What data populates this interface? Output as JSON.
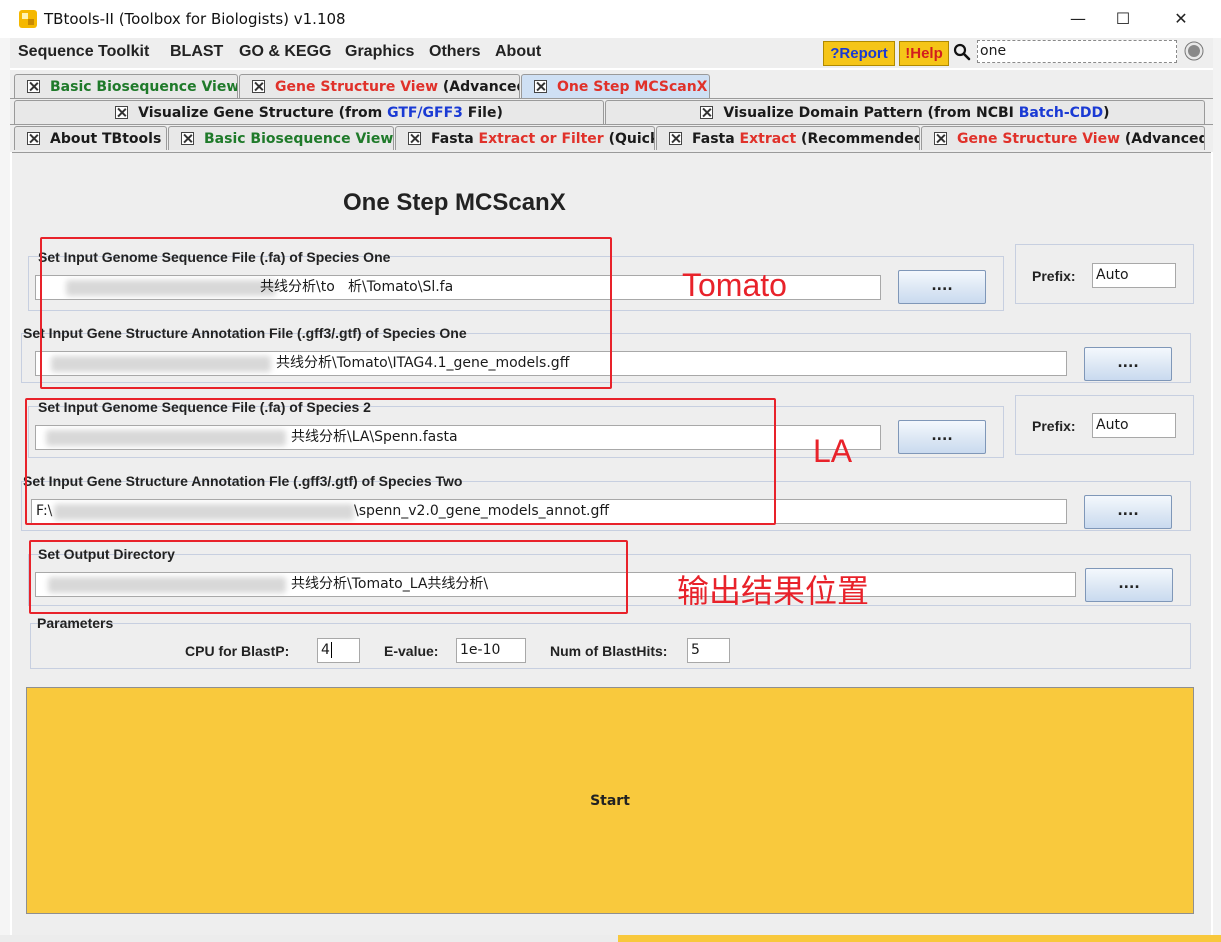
{
  "window": {
    "title": "TBtools-II (Toolbox for Biologists) v1.108",
    "minimize": "—",
    "maximize": "☐",
    "close": "✕"
  },
  "menu": {
    "items": [
      "Sequence Toolkit",
      "BLAST",
      "GO & KEGG",
      "Graphics",
      "Others",
      "About"
    ],
    "report_label": "?Report",
    "help_label": "!Help",
    "search_value": "one"
  },
  "tabs": {
    "row1": [
      {
        "parts": [
          {
            "text": "Basic Biosequence View",
            "color": "green"
          }
        ]
      },
      {
        "parts": [
          {
            "text": "Gene Structure View",
            "color": "red"
          },
          {
            "text": " (Advanced)",
            "color": "black"
          }
        ]
      },
      {
        "parts": [
          {
            "text": "One Step MCScanX",
            "color": "red"
          }
        ],
        "active": true
      }
    ],
    "row2": [
      {
        "parts": [
          {
            "text": "Visualize Gene Structure (from ",
            "color": "black"
          },
          {
            "text": "GTF/GFF3",
            "color": "blue"
          },
          {
            "text": " File)",
            "color": "black"
          }
        ]
      },
      {
        "parts": [
          {
            "text": "Visualize Domain Pattern (from NCBI ",
            "color": "black"
          },
          {
            "text": "Batch-CDD",
            "color": "blue"
          },
          {
            "text": ")",
            "color": "black"
          }
        ]
      }
    ],
    "row3": [
      {
        "parts": [
          {
            "text": "About TBtools",
            "color": "black"
          }
        ]
      },
      {
        "parts": [
          {
            "text": "Basic Biosequence View",
            "color": "green"
          }
        ]
      },
      {
        "parts": [
          {
            "text": "Fasta ",
            "color": "black"
          },
          {
            "text": "Extract or Filter",
            "color": "red"
          },
          {
            "text": " (Quick)",
            "color": "black"
          }
        ]
      },
      {
        "parts": [
          {
            "text": "Fasta ",
            "color": "black"
          },
          {
            "text": "Extract",
            "color": "red"
          },
          {
            "text": " (Recommended)",
            "color": "black"
          }
        ]
      },
      {
        "parts": [
          {
            "text": "Gene Structure View",
            "color": "red"
          },
          {
            "text": " (Advanced)",
            "color": "black"
          }
        ]
      }
    ]
  },
  "form": {
    "heading": "One Step MCScanX",
    "genome1": {
      "label": "Set Input Genome Sequence File (.fa) of Species One",
      "value": "析\\Tomato\\Sl.fa",
      "partial": "共线分析\\to"
    },
    "gff1": {
      "label": "Set Input Gene Structure Annotation File (.gff3/.gtf) of Species One",
      "value": "共线分析\\Tomato\\ITAG4.1_gene_models.gff"
    },
    "genome2": {
      "label": "Set Input Genome Sequence File (.fa) of Species 2",
      "value": "共线分析\\LA\\Spenn.fasta"
    },
    "gff2": {
      "label": "Set Input Gene Structure Annotation Fle (.gff3/.gtf) of Species Two",
      "prefix_drive": "F:\\",
      "value": "\\spenn_v2.0_gene_models_annot.gff"
    },
    "output": {
      "label": "Set Output Directory",
      "value": "共线分析\\Tomato_LA共线分析\\"
    },
    "browse_label": "....",
    "prefix_label": "Prefix:",
    "prefix1": "Auto",
    "prefix2": "Auto",
    "params": {
      "title": "Parameters",
      "cpu_label": "CPU for BlastP:",
      "cpu_value": "4",
      "evalue_label": "E-value:",
      "evalue_value": "1e-10",
      "hits_label": "Num of BlastHits:",
      "hits_value": "5"
    },
    "start_label": "Start"
  },
  "annotations": {
    "species1": "Tomato",
    "species2": "LA",
    "output": "输出结果位置"
  },
  "colors": {
    "start_button": "#f9c93d",
    "annotation_red": "#e8222a",
    "tab_green": "#1f7a2a",
    "tab_red": "#e0312a",
    "tab_blue": "#1a3ad4"
  }
}
